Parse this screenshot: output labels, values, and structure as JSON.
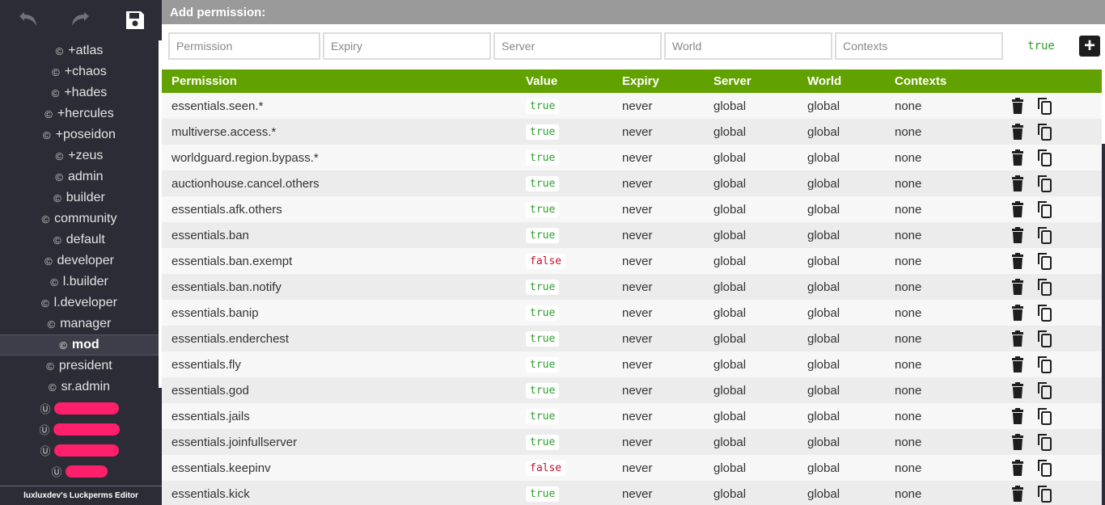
{
  "toolbar": {
    "undo_icon": "undo-icon",
    "redo_icon": "redo-icon",
    "save_icon": "save-icon"
  },
  "sidebar": {
    "group_icon": "©",
    "user_icon": "Ⓤ",
    "groups": [
      "+atlas",
      "+chaos",
      "+hades",
      "+hercules",
      "+poseidon",
      "+zeus",
      "admin",
      "builder",
      "community",
      "default",
      "developer",
      "l.builder",
      "l.developer",
      "manager",
      "mod",
      "president",
      "sr.admin"
    ],
    "active_group": "mod",
    "footer": "luxluxdev's Luckperms Editor"
  },
  "add_permission": {
    "title": "Add permission:",
    "permission_placeholder": "Permission",
    "expiry_placeholder": "Expiry",
    "server_placeholder": "Server",
    "world_placeholder": "World",
    "contexts_placeholder": "Contexts",
    "value": "true",
    "add_label": "+"
  },
  "table": {
    "headers": {
      "permission": "Permission",
      "value": "Value",
      "expiry": "Expiry",
      "server": "Server",
      "world": "World",
      "contexts": "Contexts"
    },
    "rows": [
      {
        "permission": "essentials.seen.*",
        "value": "true",
        "expiry": "never",
        "server": "global",
        "world": "global",
        "contexts": "none"
      },
      {
        "permission": "multiverse.access.*",
        "value": "true",
        "expiry": "never",
        "server": "global",
        "world": "global",
        "contexts": "none"
      },
      {
        "permission": "worldguard.region.bypass.*",
        "value": "true",
        "expiry": "never",
        "server": "global",
        "world": "global",
        "contexts": "none"
      },
      {
        "permission": "auctionhouse.cancel.others",
        "value": "true",
        "expiry": "never",
        "server": "global",
        "world": "global",
        "contexts": "none"
      },
      {
        "permission": "essentials.afk.others",
        "value": "true",
        "expiry": "never",
        "server": "global",
        "world": "global",
        "contexts": "none"
      },
      {
        "permission": "essentials.ban",
        "value": "true",
        "expiry": "never",
        "server": "global",
        "world": "global",
        "contexts": "none"
      },
      {
        "permission": "essentials.ban.exempt",
        "value": "false",
        "expiry": "never",
        "server": "global",
        "world": "global",
        "contexts": "none"
      },
      {
        "permission": "essentials.ban.notify",
        "value": "true",
        "expiry": "never",
        "server": "global",
        "world": "global",
        "contexts": "none"
      },
      {
        "permission": "essentials.banip",
        "value": "true",
        "expiry": "never",
        "server": "global",
        "world": "global",
        "contexts": "none"
      },
      {
        "permission": "essentials.enderchest",
        "value": "true",
        "expiry": "never",
        "server": "global",
        "world": "global",
        "contexts": "none"
      },
      {
        "permission": "essentials.fly",
        "value": "true",
        "expiry": "never",
        "server": "global",
        "world": "global",
        "contexts": "none"
      },
      {
        "permission": "essentials.god",
        "value": "true",
        "expiry": "never",
        "server": "global",
        "world": "global",
        "contexts": "none"
      },
      {
        "permission": "essentials.jails",
        "value": "true",
        "expiry": "never",
        "server": "global",
        "world": "global",
        "contexts": "none"
      },
      {
        "permission": "essentials.joinfullserver",
        "value": "true",
        "expiry": "never",
        "server": "global",
        "world": "global",
        "contexts": "none"
      },
      {
        "permission": "essentials.keepinv",
        "value": "false",
        "expiry": "never",
        "server": "global",
        "world": "global",
        "contexts": "none"
      },
      {
        "permission": "essentials.kick",
        "value": "true",
        "expiry": "never",
        "server": "global",
        "world": "global",
        "contexts": "none"
      }
    ]
  }
}
